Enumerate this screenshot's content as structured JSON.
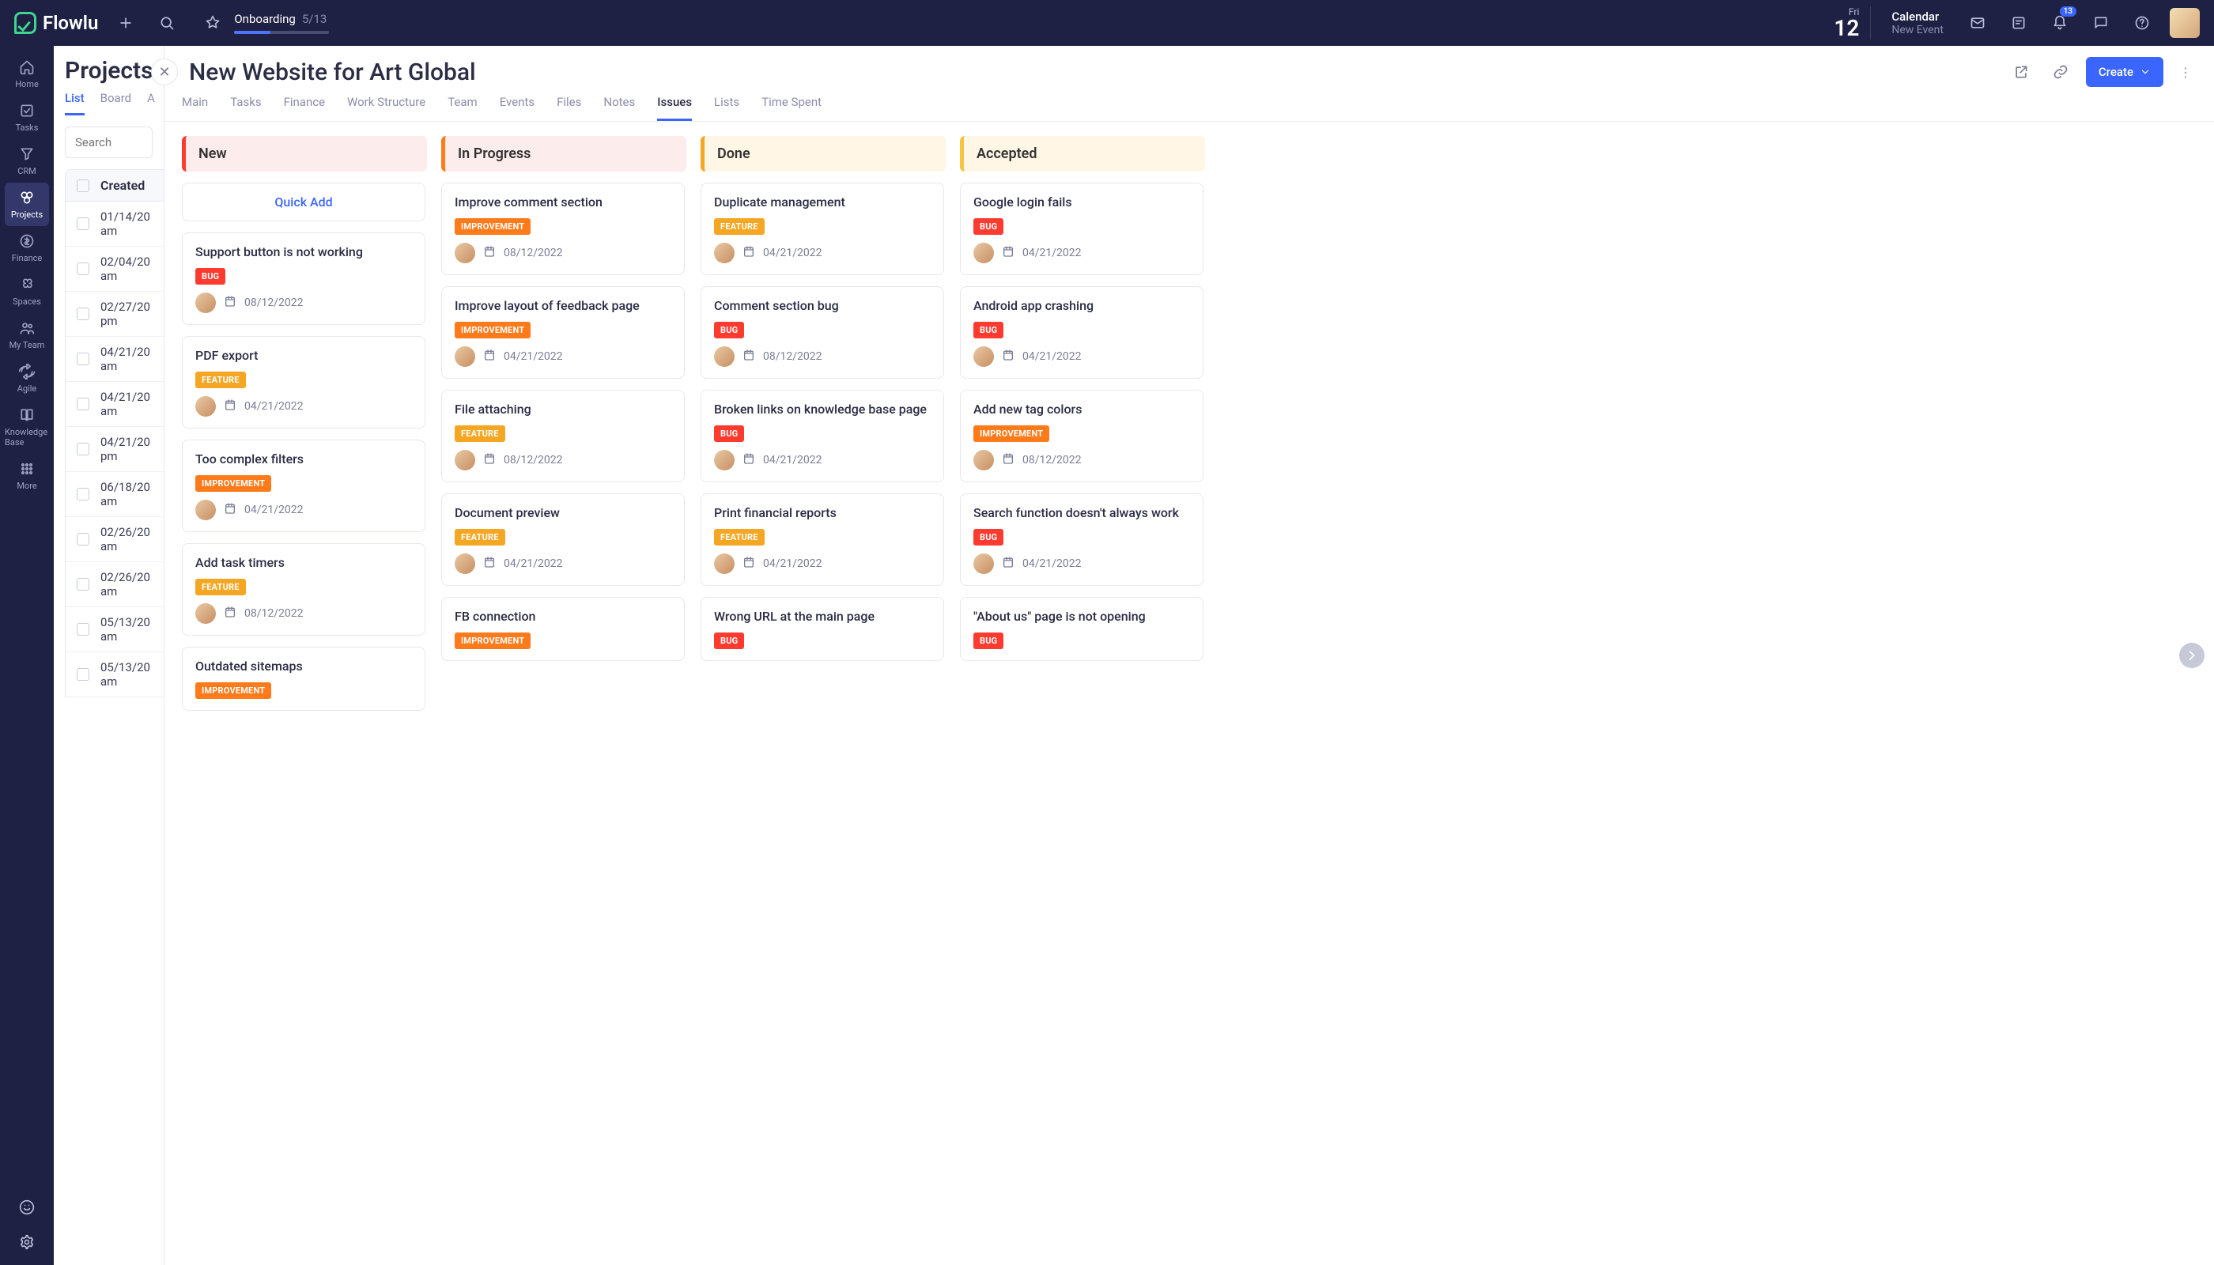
{
  "brand": "Flowlu",
  "onboarding": {
    "label": "Onboarding",
    "progress": "5/13"
  },
  "date": {
    "dow": "Fri",
    "day": "12"
  },
  "calendar": {
    "title": "Calendar",
    "subtitle": "New Event"
  },
  "notif_count": "13",
  "sidenav": [
    {
      "label": "Home",
      "icon": "home"
    },
    {
      "label": "Tasks",
      "icon": "tasks"
    },
    {
      "label": "CRM",
      "icon": "funnel"
    },
    {
      "label": "Projects",
      "icon": "projects",
      "active": true
    },
    {
      "label": "Finance",
      "icon": "finance"
    },
    {
      "label": "Spaces",
      "icon": "spaces"
    },
    {
      "label": "My Team",
      "icon": "team"
    },
    {
      "label": "Agile",
      "icon": "agile"
    },
    {
      "label": "Knowledge Base",
      "icon": "kb"
    },
    {
      "label": "More",
      "icon": "more"
    }
  ],
  "listpanel": {
    "title": "Projects",
    "tabs": [
      "List",
      "Board",
      "A"
    ],
    "active_tab": "List",
    "search_placeholder": "Search",
    "header": "Created",
    "rows": [
      "01/14/20 am",
      "02/04/20 am",
      "02/27/20 pm",
      "04/21/20 am",
      "04/21/20 am",
      "04/21/20 pm",
      "06/18/20 am",
      "02/26/20 am",
      "02/26/20 am",
      "05/13/20 am",
      "05/13/20 am"
    ]
  },
  "project": {
    "title": "New Website for Art Global",
    "create_label": "Create",
    "tabs": [
      "Main",
      "Tasks",
      "Finance",
      "Work Structure",
      "Team",
      "Events",
      "Files",
      "Notes",
      "Issues",
      "Lists",
      "Time Spent"
    ],
    "active_tab": "Issues"
  },
  "board": {
    "quick_add": "Quick Add",
    "columns": [
      {
        "key": "new",
        "title": "New",
        "hdrClass": "hdr-new",
        "quick_add": true,
        "cards": [
          {
            "title": "Support button is not working",
            "tag": "BUG",
            "tagClass": "bug",
            "date": "08/12/2022"
          },
          {
            "title": "PDF export",
            "tag": "FEATURE",
            "tagClass": "feature",
            "date": "04/21/2022"
          },
          {
            "title": "Too complex filters",
            "tag": "IMPROVEMENT",
            "tagClass": "improvement",
            "date": "04/21/2022"
          },
          {
            "title": "Add task timers",
            "tag": "FEATURE",
            "tagClass": "feature",
            "date": "08/12/2022"
          },
          {
            "title": "Outdated sitemaps",
            "tag": "IMPROVEMENT",
            "tagClass": "improvement",
            "date": ""
          }
        ]
      },
      {
        "key": "progress",
        "title": "In Progress",
        "hdrClass": "hdr-progress",
        "cards": [
          {
            "title": "Improve comment section",
            "tag": "IMPROVEMENT",
            "tagClass": "improvement",
            "date": "08/12/2022"
          },
          {
            "title": "Improve layout of feedback page",
            "tag": "IMPROVEMENT",
            "tagClass": "improvement",
            "date": "04/21/2022"
          },
          {
            "title": "File attaching",
            "tag": "FEATURE",
            "tagClass": "feature",
            "date": "08/12/2022"
          },
          {
            "title": "Document preview",
            "tag": "FEATURE",
            "tagClass": "feature",
            "date": "04/21/2022"
          },
          {
            "title": "FB connection",
            "tag": "IMPROVEMENT",
            "tagClass": "improvement",
            "date": ""
          }
        ]
      },
      {
        "key": "done",
        "title": "Done",
        "hdrClass": "hdr-done",
        "cards": [
          {
            "title": "Duplicate management",
            "tag": "FEATURE",
            "tagClass": "feature",
            "date": "04/21/2022"
          },
          {
            "title": "Comment section bug",
            "tag": "BUG",
            "tagClass": "bug",
            "date": "08/12/2022"
          },
          {
            "title": "Broken links on knowledge base page",
            "tag": "BUG",
            "tagClass": "bug",
            "date": "04/21/2022"
          },
          {
            "title": "Print financial reports",
            "tag": "FEATURE",
            "tagClass": "feature",
            "date": "04/21/2022"
          },
          {
            "title": "Wrong URL at the main page",
            "tag": "BUG",
            "tagClass": "bug",
            "date": ""
          }
        ]
      },
      {
        "key": "accepted",
        "title": "Accepted",
        "hdrClass": "hdr-accepted",
        "cards": [
          {
            "title": "Google login fails",
            "tag": "BUG",
            "tagClass": "bug",
            "date": "04/21/2022"
          },
          {
            "title": "Android app crashing",
            "tag": "BUG",
            "tagClass": "bug",
            "date": "04/21/2022"
          },
          {
            "title": "Add new tag colors",
            "tag": "IMPROVEMENT",
            "tagClass": "improvement",
            "date": "08/12/2022"
          },
          {
            "title": "Search function doesn't always work",
            "tag": "BUG",
            "tagClass": "bug",
            "date": "04/21/2022"
          },
          {
            "title": "\"About us\" page is not opening",
            "tag": "BUG",
            "tagClass": "bug",
            "date": ""
          }
        ]
      }
    ]
  }
}
